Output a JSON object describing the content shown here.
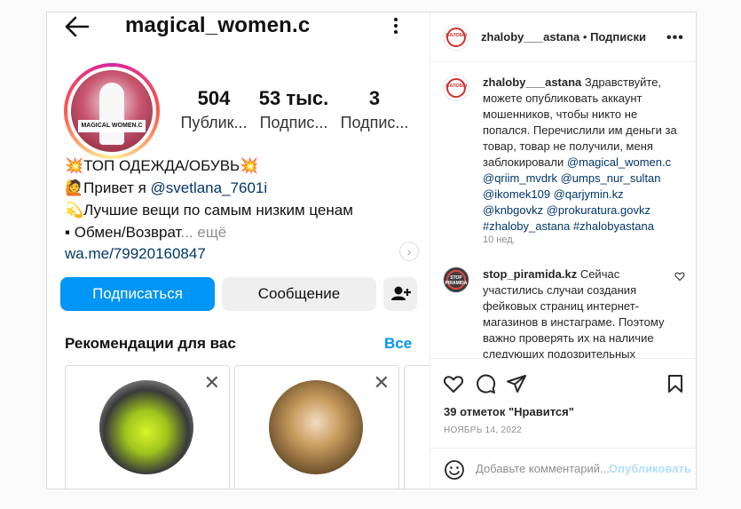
{
  "profile": {
    "username": "magical_women.c",
    "avatar_label": "MAGICAL WOMEN.C",
    "stats": [
      {
        "number": "504",
        "label": "Публик..."
      },
      {
        "number": "53 тыс.",
        "label": "Подпис..."
      },
      {
        "number": "3",
        "label": "Подпис..."
      }
    ],
    "bio": {
      "line1": "💥ТОП ОДЕЖДА/ОБУВЬ💥",
      "line2_prefix": "🙋Привет я ",
      "line2_mention": "@svetlana_7601i",
      "line3": "💫Лучшие вещи по самым низким ценам",
      "line4_text": "▪ Обмен/Возврат",
      "line4_more": "... ещё",
      "link": "wa.me/79920160847"
    },
    "buttons": {
      "follow": "Подписаться",
      "message": "Сообщение"
    },
    "recommendations": {
      "title": "Рекомендации для вас",
      "see_all": "Все"
    }
  },
  "post": {
    "author": "zhaloby___astana",
    "author_avatar_label": "ЖАЛОБЫ",
    "separator": " • ",
    "follow_label": "Подписки",
    "comments": [
      {
        "user": "zhaloby___astana",
        "text": " Здравствуйте, можете опубликовать аккаунт мошенников, чтобы никто не попался. Перечислили им деньги за товар, товар не получили, меня заблокировали ",
        "links": "@magical_women.c @qriim_mvdrk @umps_nur_sultan @ikomek109 @qarjymin.kz @knbgovkz @prokuratura.govkz #zhaloby_astana #zhalobyastana",
        "time": "10 нед."
      },
      {
        "user": "stop_piramida.kz",
        "avatar_label": "STOP PIRAMIDA",
        "text": " Сейчас участились случаи создания фейковых страниц интернет-магазинов в инстаграме. Поэтому важно проверять их на наличие следующих подозрительных признаков – закрытые"
      }
    ],
    "likes": "39 отметок \"Нравится\"",
    "date": "НОЯБРЬ 14, 2022",
    "comment_placeholder": "Добавьте комментарий...",
    "publish_label": "Опубликовать"
  }
}
